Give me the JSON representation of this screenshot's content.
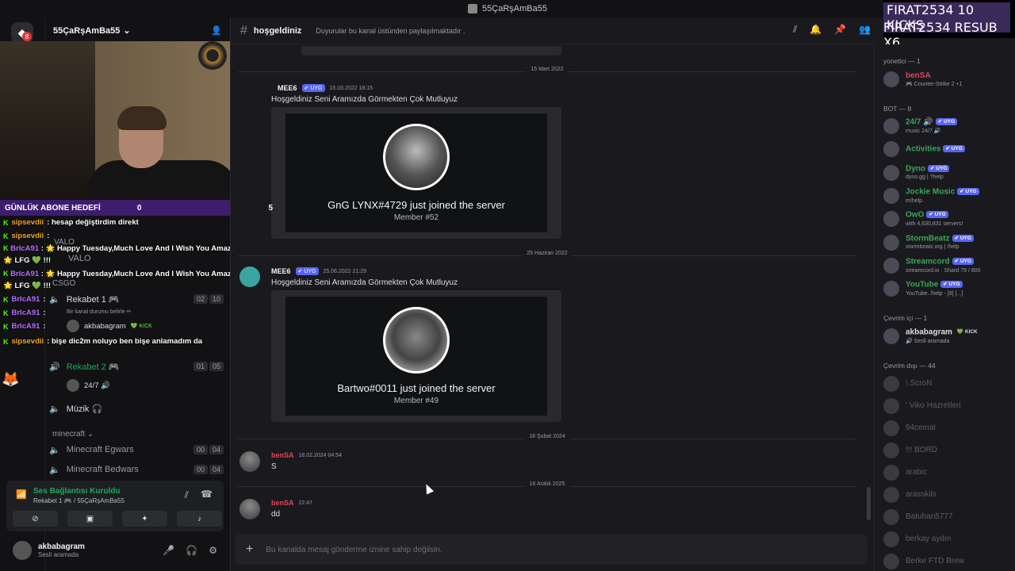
{
  "window": {
    "title": "55ÇaRşAmBa55"
  },
  "server": {
    "name": "55ÇaRşAmBa55",
    "badge": "8"
  },
  "goal": {
    "label": "GÜNLÜK ABONE HEDEFİ",
    "current": "0",
    "target": "5",
    "progress": 0
  },
  "overlay_chat": [
    {
      "user": "sipsevdii",
      "msg": ": hesap değiştirdim direkt"
    },
    {
      "user": "sipsevdii",
      "msg": ":"
    },
    {
      "user": "BrIcA91",
      "msg": ": 🌟 Happy Tuesday,Much Love And I Wish You Amazing Stream !!! 🌟 LFG 💚 !!!"
    },
    {
      "user": "BrIcA91",
      "msg": ": 🌟 Happy Tuesday,Much Love And I Wish You Amazing Stream !!! 🌟 LFG 💚 !!!"
    },
    {
      "user": "BrIcA91",
      "msg": ":"
    },
    {
      "user": "BrIcA91",
      "msg": ":"
    },
    {
      "user": "BrIcA91",
      "msg": ":"
    },
    {
      "user": "sipsevdii",
      "msg": ": bişe dic2m noluyo ben bişe anlamadım da"
    }
  ],
  "channels": {
    "valo_cat": "VALO",
    "valo_chan": "VALO",
    "csgo_cat": "CSGO",
    "rekabet1": {
      "name": "Rekabet 1 🎮",
      "a": "02",
      "b": "10",
      "status": "Bir kanal durumu belirle ✏"
    },
    "rekabet1_user": {
      "name": "akbabagram",
      "tag": "💚 KICK"
    },
    "rekabet2": {
      "name": "Rekabet 2 🎮",
      "a": "01",
      "b": "05"
    },
    "rekabet2_user": "24/7 🔊",
    "muzik": "Müzik 🎧",
    "minecraft_cat": "minecraft ⌄",
    "mc1": {
      "name": "Minecraft Egwars",
      "a": "00",
      "b": "04"
    },
    "mc2": {
      "name": "Minecraft Bedwars",
      "a": "00",
      "b": "04"
    }
  },
  "voice": {
    "title": "Ses Bağlantısı Kuruldu",
    "sub": "Rekabet 1 🎮 / 55ÇaRşAmBa55"
  },
  "user": {
    "name": "akbabagram",
    "status": "Sesli aramada"
  },
  "channel_header": {
    "name": "hoşgeldiniz",
    "topic": "Duyurular bu kanal üstünden paylaşılmaktadır ."
  },
  "dates": {
    "d1": "15 Mart 2022",
    "d2": "25 Haziran 2022",
    "d3": "18 Şubat 2024",
    "d4": "16 Aralık 2025"
  },
  "messages": [
    {
      "author": "MEE6",
      "tag": "✔ UYG",
      "time": "15.03.2022 18:15",
      "text": "Hoşgeldiniz Seni Aramızda Görmekten Çok Mutluyuz",
      "card_title": "GnG LYNX#4729 just joined the server",
      "card_sub": "Member #52"
    },
    {
      "author": "MEE6",
      "tag": "✔ UYG",
      "time": "25.06.2022 21:29",
      "text": "Hoşgeldiniz Seni Aramızda Görmekten Çok Mutluyuz",
      "card_title": "Bartwo#0011 just joined the server",
      "card_sub": "Member #49"
    },
    {
      "author": "benSA",
      "time": "18.02.2024 04:54",
      "text": "S"
    },
    {
      "author": "benSA",
      "time": "22:47",
      "text": "dd"
    }
  ],
  "composer": {
    "placeholder": "Bu kanalda mesaj gönderme iznine sahip değilsin."
  },
  "kicks": {
    "line1": "FIRAT2534  10 KICKS",
    "line2": "FIRAT2534  RESUB X6"
  },
  "members": {
    "sec_admin": "yonetici — 1",
    "sec_bot": "BOT — 8",
    "sec_online": "Çevrim içi — 1",
    "sec_offline": "Çevrim dışı — 44",
    "admin": [
      {
        "name": "benSA",
        "sub": "🎮 Counter-Strike 2 +1",
        "color": "#e0455a"
      }
    ],
    "bots": [
      {
        "name": "24/7 🔊",
        "sub": "music 24/7 🔊",
        "color": "#3ba55c"
      },
      {
        "name": "Activities",
        "sub": "",
        "color": "#3ba55c"
      },
      {
        "name": "Dyno",
        "sub": "dyno.gg | ?help",
        "color": "#3ba55c"
      },
      {
        "name": "Jockie Music",
        "sub": "m!help",
        "color": "#3ba55c"
      },
      {
        "name": "OwO",
        "sub": "with 4,630,831 servers!",
        "color": "#3ba55c"
      },
      {
        "name": "StormBeatz",
        "sub": "stormbeatz.org | /help",
        "color": "#3ba55c"
      },
      {
        "name": "Streamcord",
        "sub": "streamcord.io · Shard 79 / 800",
        "color": "#3ba55c"
      },
      {
        "name": "YouTube",
        "sub": "YouTube. /help - [8] [...]",
        "color": "#3ba55c"
      }
    ],
    "bot_tag": "✔ UYG",
    "online": [
      {
        "name": "akbabagram",
        "tag": "💚 KICK",
        "sub": "🔊 Sesli aramada"
      }
    ],
    "offline": [
      "!.ScroN",
      "' Viko Hazretleri",
      "94cemal",
      "!!! BORD",
      "arabic",
      "arasskils",
      "Batuhan5777",
      "berkay aydın",
      "Berke FTD Brew"
    ]
  }
}
